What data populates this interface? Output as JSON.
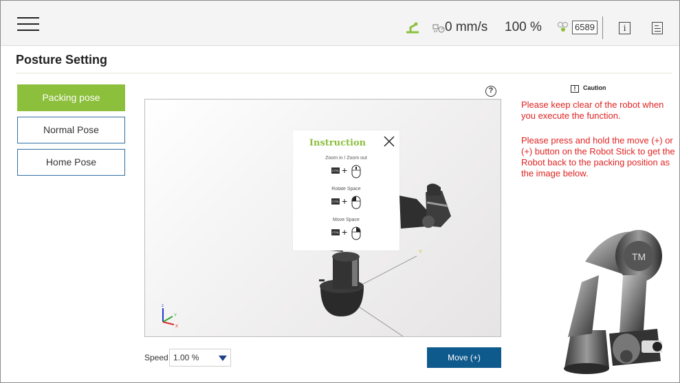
{
  "header": {
    "speed": "0 mm/s",
    "percent": "100 %",
    "counter": "6589",
    "info_glyph": "i",
    "icons": [
      "menu-icon",
      "robot-status-icon",
      "speed-icon",
      "interface-icon",
      "info-icon",
      "log-icon"
    ]
  },
  "page": {
    "title": "Posture Setting"
  },
  "poses": {
    "packing": "Packing pose",
    "normal": "Normal Pose",
    "home": "Home Pose"
  },
  "viewport": {
    "help_glyph": "?",
    "instruction": {
      "title": "Instruction",
      "zoom": "Zoom in / Zoom out",
      "rotate": "Rotate Space",
      "move": "Move Space",
      "ctrl": "CTRL",
      "plus": "+"
    },
    "axes": {
      "z": "z",
      "y": "Y",
      "x": "X"
    },
    "target_label": "Y"
  },
  "controls": {
    "speed_label": "Speed",
    "speed_value": "1.00 %",
    "move_button": "Move (+)"
  },
  "caution": {
    "title": "Caution",
    "icon_glyph": "!",
    "p1": "Please keep clear of the robot when you execute the function.",
    "p2": "Please press and hold the move (+) or (+) button on the Robot Stick to get the Robot back to the packing  position as the image below."
  },
  "colors": {
    "accent_green": "#8cbf3c",
    "button_blue": "#0f5a8d",
    "caution_red": "#e02222",
    "outline_blue": "#2f6ea5"
  }
}
